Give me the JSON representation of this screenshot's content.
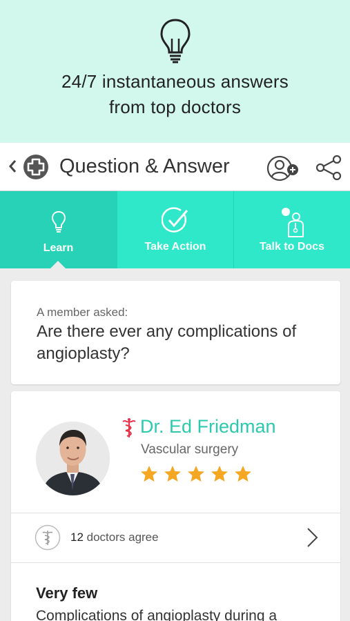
{
  "promo": {
    "headline_line1": "24/7 instantaneous answers",
    "headline_line2": "from top doctors",
    "icon": "lightbulb-icon"
  },
  "appbar": {
    "title": "Question & Answer",
    "back_icon": "chevron-left-icon",
    "logo_icon": "plus-circle-logo-icon",
    "actions": [
      "add-user-icon",
      "share-icon"
    ]
  },
  "tabs": [
    {
      "label": "Learn",
      "icon": "lightbulb-icon",
      "active": true
    },
    {
      "label": "Take Action",
      "icon": "checkmark-circle-icon",
      "active": false
    },
    {
      "label": "Talk to Docs",
      "icon": "doctor-icon",
      "active": false
    }
  ],
  "question": {
    "prefix": "A member asked:",
    "text": "Are there ever any complications of angioplasty?"
  },
  "answer": {
    "doctor_name": "Dr. Ed Friedman",
    "specialty": "Vascular surgery",
    "rating": 5,
    "agree_count": "12",
    "agree_suffix": " doctors agree",
    "title": "Very few",
    "body": "Complications of angioplasty during a"
  },
  "colors": {
    "promo_bg": "#d2f8ee",
    "tab_bg": "#2ee8c9",
    "tab_active": "#28d2b6",
    "doctor_name": "#2cc9ae",
    "star": "#f5a623",
    "caduceus": "#e5344a"
  }
}
